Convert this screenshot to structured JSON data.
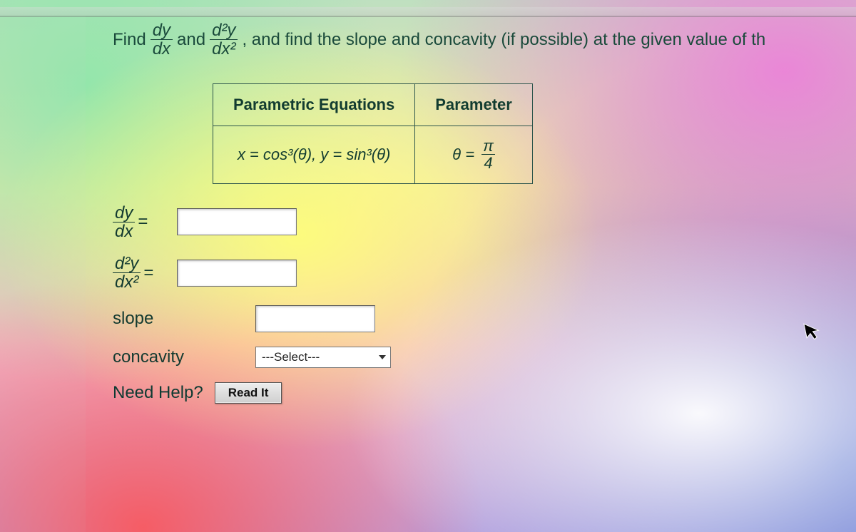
{
  "question": {
    "prefix": "Find",
    "frac1_num": "dy",
    "frac1_den": "dx",
    "and": "and",
    "frac2_num": "d²y",
    "frac2_den": "dx²",
    "rest": ", and find the slope and concavity (if possible) at the given value of th"
  },
  "table": {
    "head_eq": "Parametric Equations",
    "head_param": "Parameter",
    "eq_cell": "x = cos³(θ), y = sin³(θ)",
    "param_prefix": "θ =",
    "param_num": "π",
    "param_den": "4"
  },
  "answers": {
    "row1_num": "dy",
    "row1_den": "dx",
    "row2_num": "d²y",
    "row2_den": "dx²",
    "eq": "=",
    "slope_label": "slope",
    "concavity_label": "concavity",
    "select_placeholder": "---Select---"
  },
  "help": {
    "label": "Need Help?",
    "readit": "Read It"
  }
}
